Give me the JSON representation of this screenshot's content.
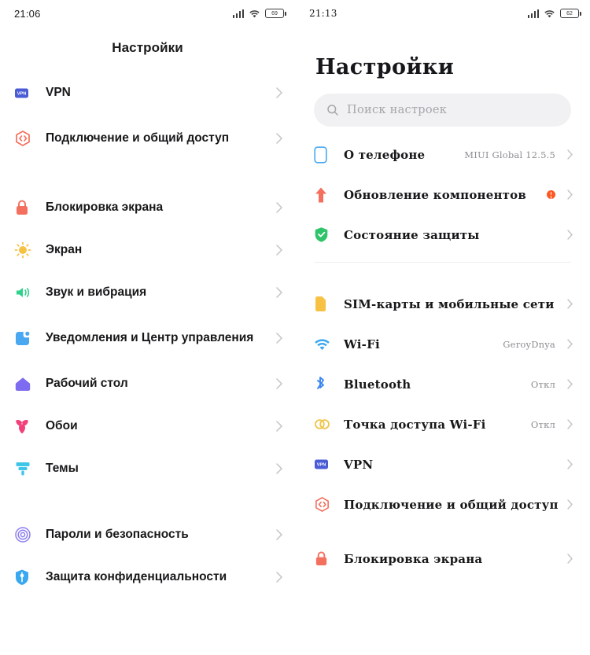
{
  "left": {
    "status": {
      "time": "21:06",
      "battery": "69",
      "signal_icon": "signal-bars-icon",
      "wifi_icon": "wifi-icon",
      "battery_icon": "battery-icon"
    },
    "title": "Настройки",
    "items": [
      {
        "label": "VPN",
        "icon": "vpn-badge-icon",
        "color": "#4a5bd6",
        "gap_before": ""
      },
      {
        "label": "Подключение и общий доступ",
        "icon": "sharing-icon",
        "color": "#f4705e",
        "gap_before": ""
      },
      {
        "label": "Блокировка экрана",
        "icon": "lock-icon",
        "color": "#f4705e",
        "gap_before": "md"
      },
      {
        "label": "Экран",
        "icon": "brightness-sun-icon",
        "color": "#f7c244",
        "gap_before": ""
      },
      {
        "label": "Звук и вибрация",
        "icon": "speaker-icon",
        "color": "#2fd18c",
        "gap_before": ""
      },
      {
        "label": "Уведомления и Центр управления",
        "icon": "notification-icon",
        "color": "#4aa8f0",
        "gap_before": ""
      },
      {
        "label": "Рабочий стол",
        "icon": "home-icon",
        "color": "#7e6cf0",
        "gap_before": ""
      },
      {
        "label": "Обои",
        "icon": "wallpaper-flower-icon",
        "color": "#f2417a",
        "gap_before": ""
      },
      {
        "label": "Темы",
        "icon": "themes-brush-icon",
        "color": "#3ec5e8",
        "gap_before": ""
      },
      {
        "label": "Пароли и безопасность",
        "icon": "fingerprint-icon",
        "color": "#8b7ff0",
        "gap_before": "md"
      },
      {
        "label": "Защита конфиденциальности",
        "icon": "privacy-shield-icon",
        "color": "#3aa8f0",
        "gap_before": ""
      }
    ]
  },
  "right": {
    "status": {
      "time": "21:13",
      "battery": "62",
      "signal_icon": "signal-bars-icon",
      "wifi_icon": "wifi-icon",
      "battery_icon": "battery-icon"
    },
    "title": "Настройки",
    "search": {
      "placeholder": "Поиск настроек",
      "icon": "search-icon"
    },
    "items": [
      {
        "label": "О телефоне",
        "value": "MIUI Global 12.5.5",
        "icon": "phone-outline-icon",
        "color": "#4aa8f0",
        "badge": false
      },
      {
        "label": "Обновление компонентов",
        "value": "",
        "icon": "up-arrow-icon",
        "color": "#f4705e",
        "badge": true
      },
      {
        "label": "Состояние защиты",
        "value": "",
        "icon": "shield-check-icon",
        "color": "#2fc46a",
        "badge": false
      },
      {
        "label": "SIM-карты и мобильные сети",
        "value": "",
        "icon": "sim-card-icon",
        "color": "#f7c244",
        "badge": false
      },
      {
        "label": "Wi-Fi",
        "value": "GeroyDnya",
        "icon": "wifi-icon",
        "color": "#3aa8f0",
        "badge": false
      },
      {
        "label": "Bluetooth",
        "value": "Откл",
        "icon": "bluetooth-icon",
        "color": "#3a86f0",
        "badge": false
      },
      {
        "label": "Точка доступа Wi-Fi",
        "value": "Откл",
        "icon": "hotspot-icon",
        "color": "#f0c44a",
        "badge": false
      },
      {
        "label": "VPN",
        "value": "",
        "icon": "vpn-badge-icon",
        "color": "#4a5bd6",
        "badge": false
      },
      {
        "label": "Подключение и общий доступ",
        "value": "",
        "icon": "sharing-icon",
        "color": "#f4705e",
        "badge": false
      },
      {
        "label": "Блокировка экрана",
        "value": "",
        "icon": "lock-icon",
        "color": "#f4705e",
        "badge": false
      }
    ]
  },
  "colors": {
    "accent_badge": "#ff5722",
    "text_primary": "#18181a",
    "text_secondary": "#8e8e93",
    "search_bg": "#f1f1f3"
  }
}
